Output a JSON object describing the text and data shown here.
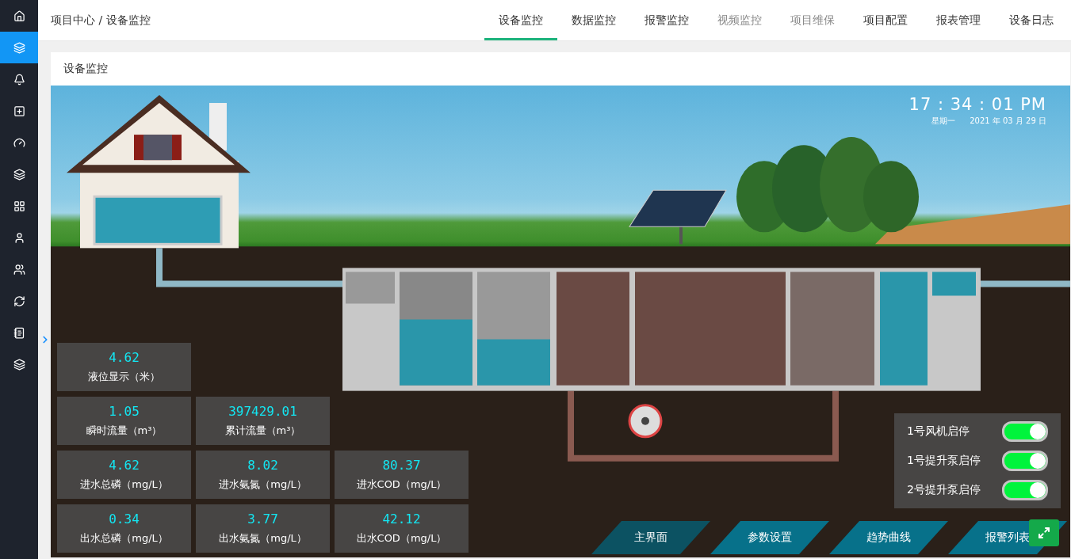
{
  "sidebar": {
    "items": [
      {
        "selected": false
      },
      {
        "selected": true
      },
      {
        "selected": false
      },
      {
        "selected": false
      },
      {
        "selected": false
      },
      {
        "selected": false
      },
      {
        "selected": false
      },
      {
        "selected": false
      },
      {
        "selected": false
      },
      {
        "selected": false
      },
      {
        "selected": false
      },
      {
        "selected": false
      }
    ]
  },
  "breadcrumb": "项目中心 / 设备监控",
  "tabs": [
    {
      "label": "设备监控",
      "selected": true,
      "disabled": false
    },
    {
      "label": "数据监控",
      "selected": false,
      "disabled": false
    },
    {
      "label": "报警监控",
      "selected": false,
      "disabled": false
    },
    {
      "label": "视频监控",
      "selected": false,
      "disabled": true
    },
    {
      "label": "项目维保",
      "selected": false,
      "disabled": true
    },
    {
      "label": "项目配置",
      "selected": false,
      "disabled": false
    },
    {
      "label": "报表管理",
      "selected": false,
      "disabled": false
    },
    {
      "label": "设备日志",
      "selected": false,
      "disabled": false
    }
  ],
  "panel": {
    "title": "设备监控"
  },
  "clock": {
    "time": "17 : 34 : 01 PM",
    "weekday": "星期一",
    "date": "2021 年 03 月 29 日"
  },
  "readings": [
    [
      {
        "value": "4.62",
        "label": "液位显示（米）"
      }
    ],
    [
      {
        "value": "1.05",
        "label": "瞬时流量（m³）"
      },
      {
        "value": "397429.01",
        "label": "累计流量（m³）"
      }
    ],
    [
      {
        "value": "4.62",
        "label": "进水总磷（mg/L）"
      },
      {
        "value": "8.02",
        "label": "进水氨氮（mg/L）"
      },
      {
        "value": "80.37",
        "label": "进水COD（mg/L）"
      }
    ],
    [
      {
        "value": "0.34",
        "label": "出水总磷（mg/L）"
      },
      {
        "value": "3.77",
        "label": "出水氨氮（mg/L）"
      },
      {
        "value": "42.12",
        "label": "出水COD（mg/L）"
      }
    ]
  ],
  "toggles": [
    {
      "label": "1号风机启停",
      "on": true
    },
    {
      "label": "1号提升泵启停",
      "on": true
    },
    {
      "label": "2号提升泵启停",
      "on": true
    }
  ],
  "bottom_nav": [
    {
      "label": "主界面",
      "selected": true
    },
    {
      "label": "参数设置",
      "selected": false
    },
    {
      "label": "趋势曲线",
      "selected": false
    },
    {
      "label": "报警列表",
      "selected": false
    }
  ]
}
